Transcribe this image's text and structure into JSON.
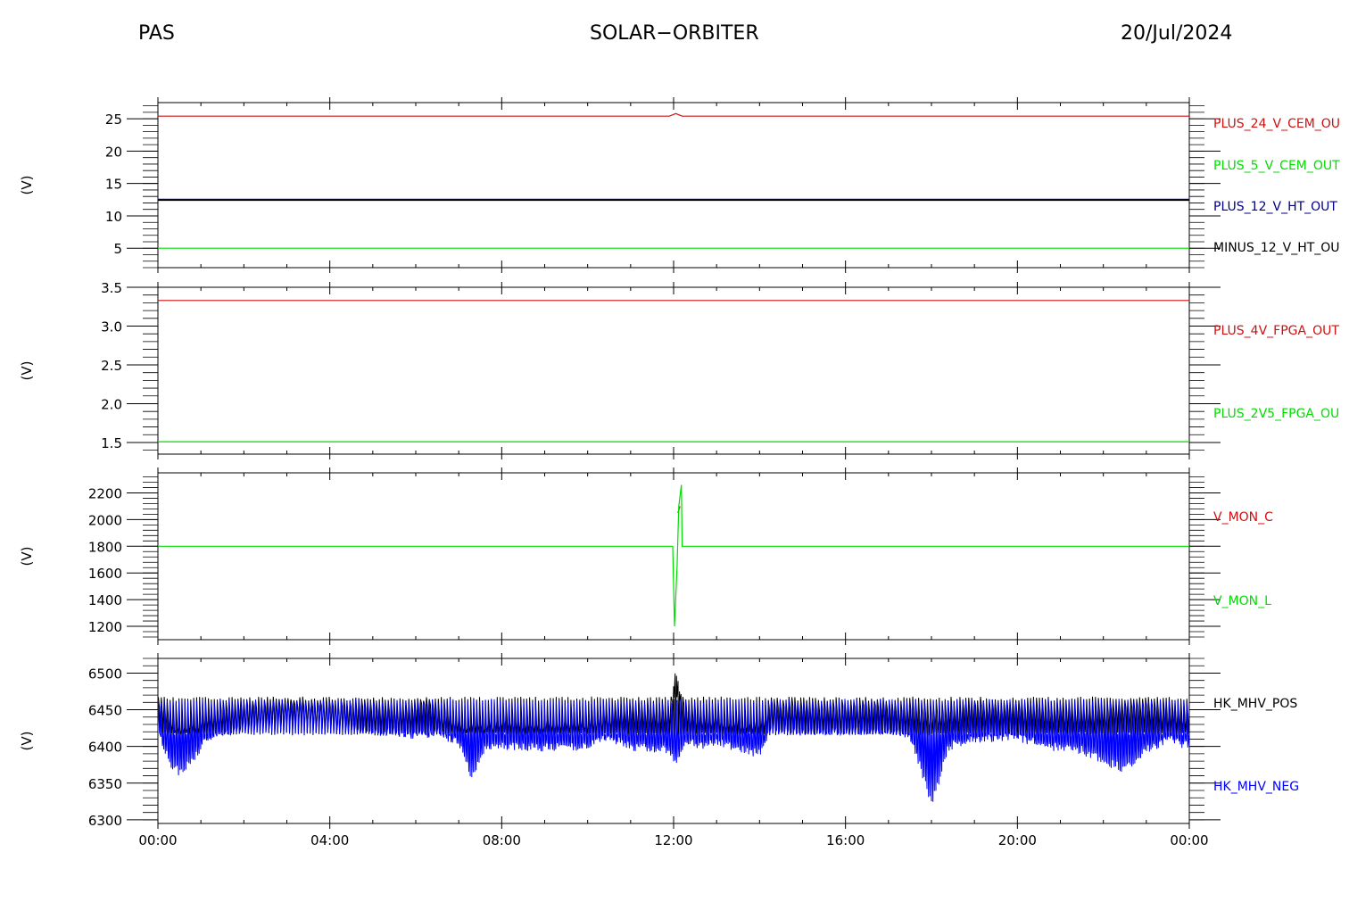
{
  "header": {
    "left": "PAS",
    "center": "SOLAR−ORBITER",
    "right": "20/Jul/2024"
  },
  "colors": {
    "red": "#d01010",
    "green": "#00dd00",
    "navy": "#000080",
    "blue": "#0000ff",
    "black": "#000000"
  },
  "chart_data": [
    {
      "type": "line",
      "ylabel": "(V)",
      "ylim": [
        2,
        27.5
      ],
      "yticks": [
        5,
        10,
        15,
        20,
        25
      ],
      "ytick_labels": [
        "5",
        "10",
        "15",
        "20",
        "25"
      ],
      "xlim_hours": [
        0,
        24
      ],
      "series": [
        {
          "name": "PLUS_24_V_CEM_OU",
          "color": "#d01010",
          "x": [
            0,
            11.9,
            12.05,
            12.2,
            24
          ],
          "y": [
            25.4,
            25.4,
            25.8,
            25.4,
            25.4
          ]
        },
        {
          "name": "PLUS_5_V_CEM_OUT",
          "color": "#00dd00",
          "x": [
            0,
            24
          ],
          "y": [
            5.0,
            5.0
          ]
        },
        {
          "name": "PLUS_12_V_HT_OUT",
          "color": "#000080",
          "x": [
            0,
            24
          ],
          "y": [
            12.5,
            12.5
          ]
        },
        {
          "name": "MINUS_12_V_HT_OU",
          "color": "#000000",
          "x": [
            0,
            24
          ],
          "y": [
            12.4,
            12.4
          ]
        }
      ]
    },
    {
      "type": "line",
      "ylabel": "(V)",
      "ylim": [
        1.35,
        3.5
      ],
      "yticks": [
        1.5,
        2.0,
        2.5,
        3.0,
        3.5
      ],
      "ytick_labels": [
        "1.5",
        "2.0",
        "2.5",
        "3.0",
        "3.5"
      ],
      "xlim_hours": [
        0,
        24
      ],
      "series": [
        {
          "name": "PLUS_4V_FPGA_OUT",
          "color": "#d01010",
          "x": [
            0,
            24
          ],
          "y": [
            3.33,
            3.33
          ]
        },
        {
          "name": "PLUS_2V5_FPGA_OU",
          "color": "#00dd00",
          "x": [
            0,
            24
          ],
          "y": [
            1.51,
            1.51
          ]
        }
      ]
    },
    {
      "type": "line",
      "ylabel": "(V)",
      "ylim": [
        1100,
        2350
      ],
      "yticks": [
        1200,
        1400,
        1600,
        1800,
        2000,
        2200
      ],
      "ytick_labels": [
        "1200",
        "1400",
        "1600",
        "1800",
        "2000",
        "2200"
      ],
      "xlim_hours": [
        0,
        24
      ],
      "series": [
        {
          "name": "V_MON_C",
          "color": "#d01010",
          "x": [
            12.1,
            12.15
          ],
          "y": [
            2050,
            2100
          ]
        },
        {
          "name": "V_MON_L",
          "color": "#00dd00",
          "x": [
            0,
            11.98,
            12.02,
            12.08,
            12.12,
            12.18,
            12.2,
            24
          ],
          "y": [
            1800,
            1800,
            1200,
            1650,
            2100,
            2260,
            1800,
            1800
          ]
        }
      ]
    },
    {
      "type": "line",
      "ylabel": "(V)",
      "ylim": [
        6295,
        6520
      ],
      "yticks": [
        6300,
        6350,
        6400,
        6450,
        6500
      ],
      "ytick_labels": [
        "6300",
        "6350",
        "6400",
        "6450",
        "6500"
      ],
      "xlim_hours": [
        0,
        24
      ],
      "xtick_labels": [
        "00:00",
        "04:00",
        "08:00",
        "12:00",
        "16:00",
        "20:00",
        "00:00"
      ],
      "series": [
        {
          "name": "HK_MHV_POS",
          "color": "#000000",
          "hi": 6468,
          "lo": 6415,
          "x": [
            0,
            0.3,
            0.6,
            1,
            1.5,
            2,
            3,
            4,
            5,
            5.6,
            6.2,
            7,
            7.5,
            8,
            9,
            10,
            10.5,
            11,
            11.5,
            11.9,
            12.05,
            12.3,
            12.6,
            13,
            13.5,
            14,
            14.3,
            14.5,
            15,
            16,
            17,
            17.5,
            18,
            18.5,
            19,
            20,
            21,
            21.5,
            22,
            22.5,
            23,
            23.5,
            24
          ],
          "y": [
            6460,
            6430,
            6425,
            6430,
            6445,
            6450,
            6455,
            6450,
            6448,
            6440,
            6460,
            6430,
            6428,
            6432,
            6430,
            6432,
            6440,
            6445,
            6442,
            6440,
            6500,
            6440,
            6438,
            6436,
            6432,
            6430,
            6455,
            6450,
            6448,
            6450,
            6450,
            6445,
            6440,
            6445,
            6450,
            6447,
            6445,
            6440,
            6445,
            6450,
            6450,
            6445,
            6440
          ]
        },
        {
          "name": "HK_MHV_NEG",
          "color": "#0000ff",
          "hi": 6465,
          "lo": 6416,
          "x": [
            0,
            0.3,
            0.5,
            0.8,
            1.1,
            1.5,
            2,
            3,
            4,
            4.5,
            5,
            5.5,
            6,
            6.5,
            7,
            7.3,
            7.6,
            8,
            9,
            10,
            10.5,
            11,
            11.5,
            11.9,
            12.05,
            12.3,
            12.6,
            13,
            13.5,
            14,
            14.3,
            14.6,
            15,
            16,
            17,
            17.5,
            17.8,
            18,
            18.4,
            19,
            20,
            20.8,
            21.5,
            22,
            22.5,
            23,
            23.5,
            24
          ],
          "y": [
            6420,
            6375,
            6365,
            6380,
            6410,
            6420,
            6430,
            6440,
            6440,
            6430,
            6420,
            6420,
            6415,
            6420,
            6405,
            6360,
            6395,
            6400,
            6398,
            6400,
            6412,
            6400,
            6398,
            6395,
            6380,
            6410,
            6400,
            6405,
            6398,
            6390,
            6430,
            6425,
            6420,
            6422,
            6422,
            6415,
            6360,
            6320,
            6400,
            6410,
            6412,
            6400,
            6395,
            6380,
            6370,
            6395,
            6410,
            6400
          ]
        }
      ]
    }
  ]
}
